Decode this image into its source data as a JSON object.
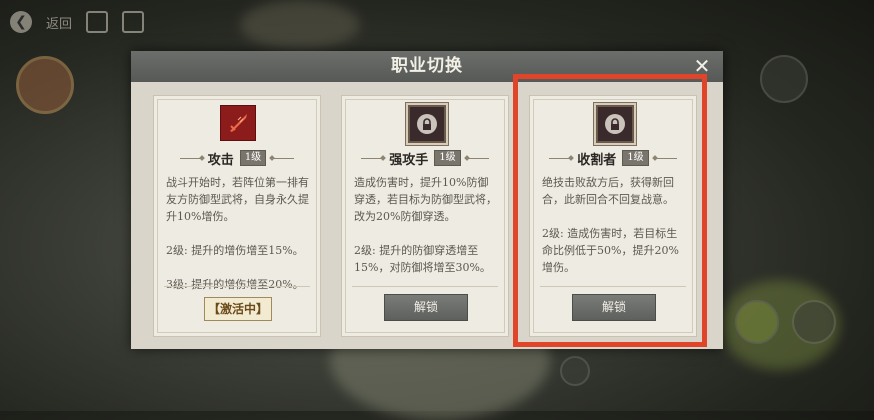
{
  "hud": {
    "back_icon": "back-arrow-icon",
    "label": "返回"
  },
  "modal": {
    "title": "职业切换",
    "close_glyph": "✕"
  },
  "cards": [
    {
      "icon": "sword-icon",
      "name": "攻击",
      "level": "1级",
      "description": "战斗开始时，若阵位第一排有友方防御型武将，自身永久提升10%增伤。\n\n2级: 提升的增伤增至15%。\n\n3级: 提升的增伤增至20%。",
      "status": "激活中"
    },
    {
      "icon": "lock-icon",
      "name": "强攻手",
      "level": "1级",
      "description": "造成伤害时，提升10%防御穿透，若目标为防御型武将，改为20%防御穿透。\n\n2级: 提升的防御穿透增至15%，对防御将增至30%。",
      "button": "解锁"
    },
    {
      "icon": "lock-icon",
      "name": "收割者",
      "level": "1级",
      "description": "绝技击败敌方后，获得新回合，此新回合不回复战意。\n\n2级: 造成伤害时，若目标生命比例低于50%，提升20%增伤。",
      "button": "解锁"
    }
  ],
  "colors": {
    "highlight": "#e0452a",
    "attack_icon_bg": "#8c1c1c",
    "header_bg": "#5f615e"
  }
}
